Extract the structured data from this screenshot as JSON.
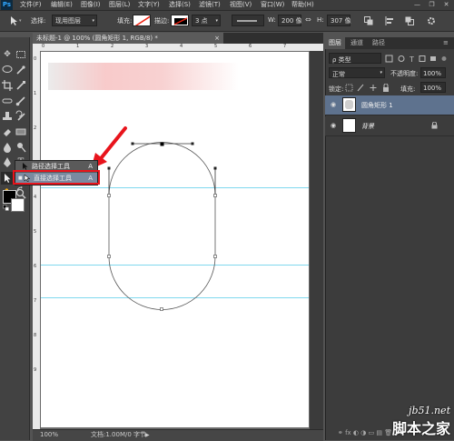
{
  "menubar": {
    "logo": "Ps",
    "items": [
      "文件(F)",
      "编辑(E)",
      "图像(I)",
      "图层(L)",
      "文字(Y)",
      "选择(S)",
      "滤镜(T)",
      "视图(V)",
      "窗口(W)",
      "帮助(H)"
    ],
    "window_controls": [
      "—",
      "❐",
      "✕"
    ]
  },
  "options": {
    "select_label": "选择:",
    "select_value": "现用图层",
    "fill_label": "填充:",
    "stroke_label": "描边:",
    "stroke_width": "3 点",
    "w_label": "W:",
    "w_value": "200 像",
    "h_label": "H:",
    "h_value": "307 像"
  },
  "document": {
    "tab_title": "未标题-1 @ 100% (圆角矩形 1, RGB/8) *",
    "tab_close": "×",
    "zoom": "100%",
    "doc_info": "文档:1.00M/0 字节",
    "ruler_h_ticks": [
      "0",
      "1",
      "2",
      "3",
      "4",
      "5",
      "6",
      "7"
    ],
    "ruler_v_ticks": [
      "0",
      "1",
      "2",
      "3",
      "4",
      "5",
      "6",
      "7",
      "8",
      "9"
    ]
  },
  "flyout": {
    "item1_label": "路径选择工具",
    "item1_key": "A",
    "item2_label": "直接选择工具",
    "item2_key": "A"
  },
  "panels": {
    "tabs": [
      "图层",
      "通道",
      "路径"
    ],
    "filter_kind": "ρ 类型",
    "blend_mode": "正常",
    "opacity_label": "不透明度:",
    "opacity_value": "100%",
    "lock_label": "锁定:",
    "fill_label": "填充:",
    "fill_value": "100%",
    "layers": [
      {
        "name": "圆角矩形 1",
        "selected": true
      },
      {
        "name": "背景",
        "selected": false
      }
    ]
  },
  "watermark": {
    "site": "jb51.net",
    "brand": "脚本之家"
  },
  "colors": {
    "guide": "#7fd8ee",
    "highlight": "#e8141c",
    "selected_layer": "#5e728e"
  }
}
